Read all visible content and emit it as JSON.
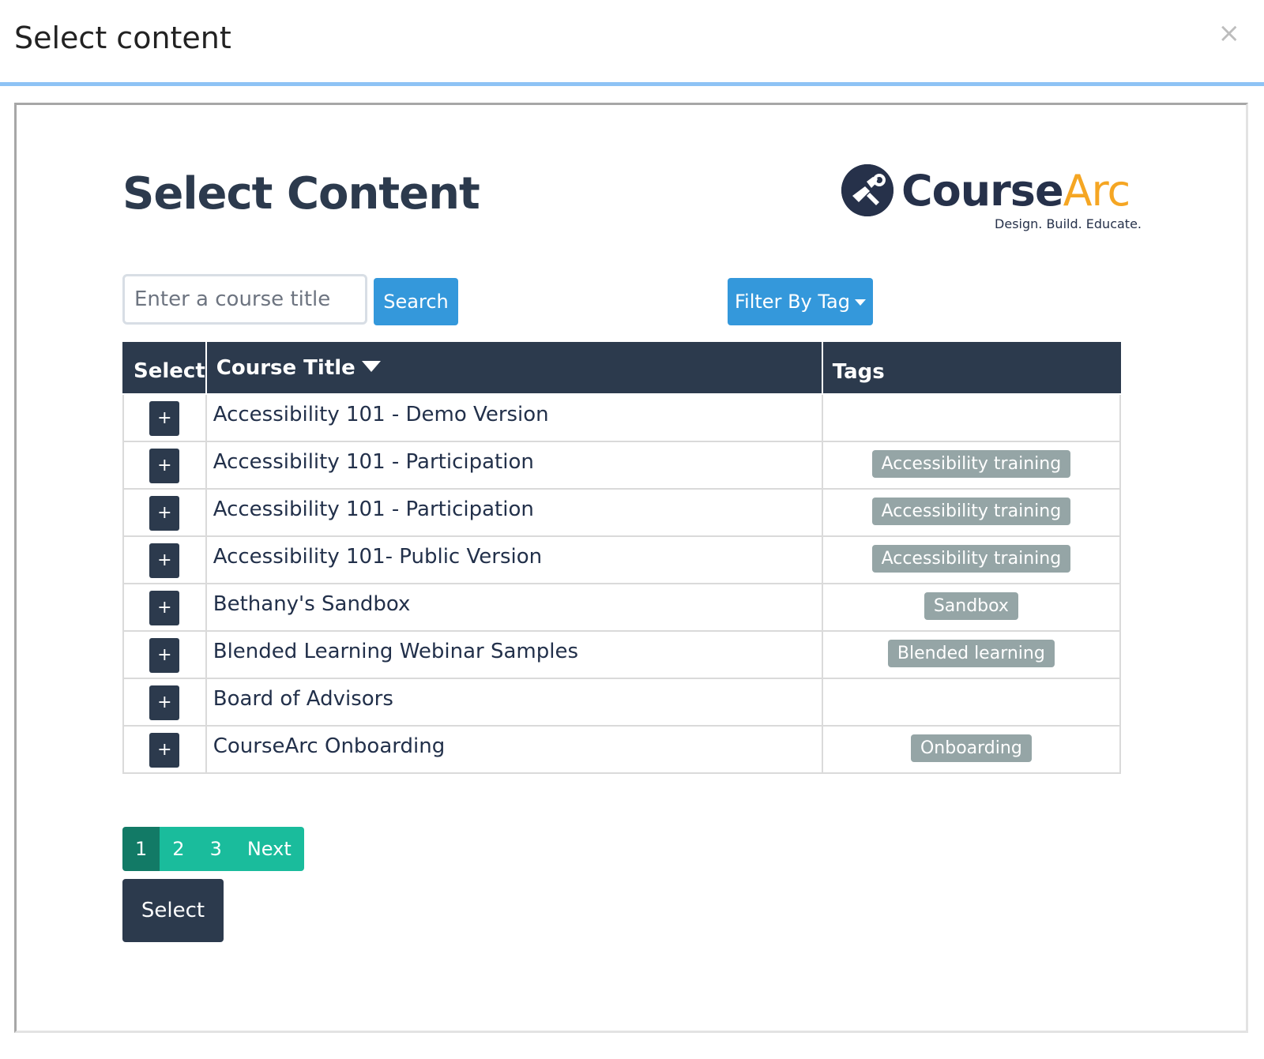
{
  "modal": {
    "title": "Select content",
    "close_symbol": "×"
  },
  "page": {
    "heading": "Select Content"
  },
  "logo": {
    "name_main": "Course",
    "name_accent": "Arc",
    "tagline": "Design. Build. Educate.",
    "brand_color": "#26314a",
    "accent_color": "#f5a623"
  },
  "search": {
    "placeholder": "Enter a course title",
    "value": "",
    "button_label": "Search"
  },
  "filter": {
    "button_label": "Filter By Tag"
  },
  "table": {
    "headers": {
      "select": "Select",
      "title": "Course Title",
      "tags": "Tags"
    },
    "rows": [
      {
        "select": "+",
        "title": "Accessibility 101 - Demo Version",
        "tag": ""
      },
      {
        "select": "+",
        "title": "Accessibility 101 - Participation",
        "tag": "Accessibility training"
      },
      {
        "select": "+",
        "title": "Accessibility 101 - Participation",
        "tag": "Accessibility training"
      },
      {
        "select": "+",
        "title": "Accessibility 101- Public Version",
        "tag": "Accessibility training"
      },
      {
        "select": "+",
        "title": "Bethany's Sandbox",
        "tag": "Sandbox"
      },
      {
        "select": "+",
        "title": "Blended Learning Webinar Samples",
        "tag": "Blended learning"
      },
      {
        "select": "+",
        "title": "Board of Advisors",
        "tag": ""
      },
      {
        "select": "+",
        "title": "CourseArc Onboarding",
        "tag": "Onboarding"
      }
    ]
  },
  "pagination": {
    "pages": [
      "1",
      "2",
      "3"
    ],
    "current": "1",
    "next_label": "Next"
  },
  "actions": {
    "select_label": "Select"
  },
  "colors": {
    "header_dark": "#2c3a4d",
    "primary_blue": "#3498db",
    "tag_gray": "#95a5a6",
    "pager_teal": "#1abc9c",
    "pager_active": "#127a66"
  }
}
